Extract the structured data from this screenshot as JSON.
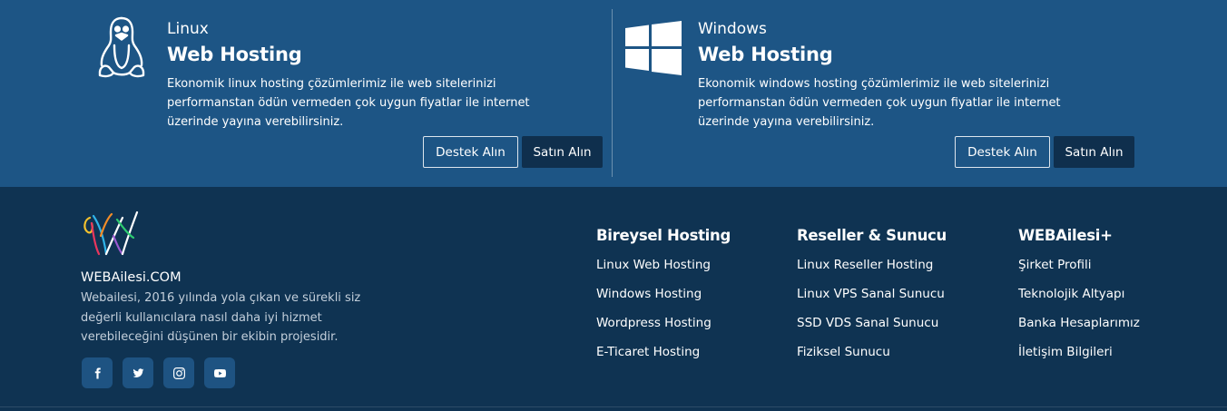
{
  "hosting_cards": [
    {
      "os": "Linux",
      "product": "Web Hosting",
      "description": "Ekonomik linux hosting çözümlerimiz ile web sitelerinizi performanstan ödün vermeden çok uygun fiyatlar ile internet üzerinde yayına verebilirsiniz.",
      "support_label": "Destek Alın",
      "buy_label": "Satın Alın",
      "icon": "linux-tux-icon"
    },
    {
      "os": "Windows",
      "product": "Web Hosting",
      "description": "Ekonomik windows hosting çözümlerimiz ile web sitelerinizi performanstan ödün vermeden çok uygun fiyatlar ile internet üzerinde yayına verebilirsiniz.",
      "support_label": "Destek Alın",
      "buy_label": "Satın Alın",
      "icon": "windows-logo-icon"
    }
  ],
  "footer": {
    "brand": {
      "name": "WEBAilesi.COM",
      "description": "Webailesi, 2016 yılında yola çıkan ve sürekli siz değerli kullanıcılara nasıl daha iyi hizmet verebileceğini düşünen bir ekibin projesidir."
    },
    "social": [
      "facebook-icon",
      "twitter-icon",
      "instagram-icon",
      "youtube-icon"
    ],
    "columns": [
      {
        "title": "Bireysel Hosting",
        "links": [
          "Linux Web Hosting",
          "Windows Hosting",
          "Wordpress Hosting",
          "E-Ticaret Hosting"
        ]
      },
      {
        "title": "Reseller & Sunucu",
        "links": [
          "Linux Reseller Hosting",
          "Linux VPS Sanal Sunucu",
          "SSD VDS Sanal Sunucu",
          "Fiziksel Sunucu"
        ]
      },
      {
        "title": "WEBAilesi+",
        "links": [
          "Şirket Profili",
          "Teknolojik Altyapı",
          "Banka Hesaplarımız",
          "İletişim Bilgileri"
        ]
      }
    ]
  },
  "colors": {
    "top_background": "#1d5585",
    "footer_background": "#0f3352",
    "solid_button": "#0f2f4d",
    "social_button": "#1e5382"
  }
}
